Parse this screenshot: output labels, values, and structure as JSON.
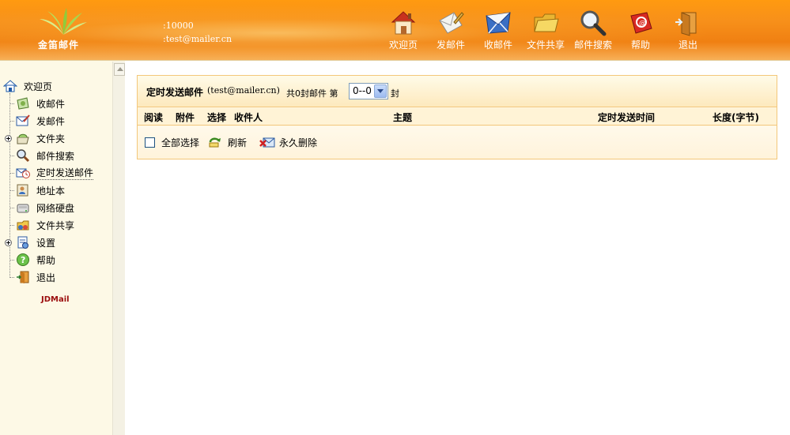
{
  "brand": {
    "logo_text": "金笛邮件",
    "footer_text": "JDMail"
  },
  "user": {
    "id": ":10000",
    "email": ":test@mailer.cn"
  },
  "nav": [
    {
      "label": "欢迎页",
      "icon": "home-icon"
    },
    {
      "label": "发邮件",
      "icon": "compose-icon"
    },
    {
      "label": "收邮件",
      "icon": "inbox-icon"
    },
    {
      "label": "文件共享",
      "icon": "folder-share-icon"
    },
    {
      "label": "邮件搜索",
      "icon": "search-icon"
    },
    {
      "label": "帮助",
      "icon": "help-book-icon"
    },
    {
      "label": "退出",
      "icon": "exit-icon"
    }
  ],
  "sidebar": {
    "root": "欢迎页",
    "items": [
      {
        "label": "收邮件"
      },
      {
        "label": "发邮件"
      },
      {
        "label": "文件夹",
        "expandable": true
      },
      {
        "label": "邮件搜索"
      },
      {
        "label": "定时发送邮件",
        "selected": true
      },
      {
        "label": "地址本"
      },
      {
        "label": "网络硬盘"
      },
      {
        "label": "文件共享"
      },
      {
        "label": "设置",
        "expandable": true
      },
      {
        "label": "帮助"
      },
      {
        "label": "退出"
      }
    ]
  },
  "panel": {
    "title": "定时发送邮件",
    "account": "(test@mailer.cn)",
    "count_text": "共0封邮件  第",
    "page_value": "0--0",
    "unit": "封",
    "columns": {
      "read": "阅读",
      "attach": "附件",
      "select": "选择",
      "recipient": "收件人",
      "subject": "主题",
      "send_time": "定时发送时间",
      "size": "长度(字节)"
    },
    "actions": {
      "select_all": "全部选择",
      "refresh": "刷新",
      "delete": "永久删除"
    }
  },
  "colors": {
    "header_orange": "#f08012",
    "sidebar_bg": "#fdf9e6",
    "panel_border": "#f3c77a",
    "brand_red": "#9b0d0d"
  }
}
